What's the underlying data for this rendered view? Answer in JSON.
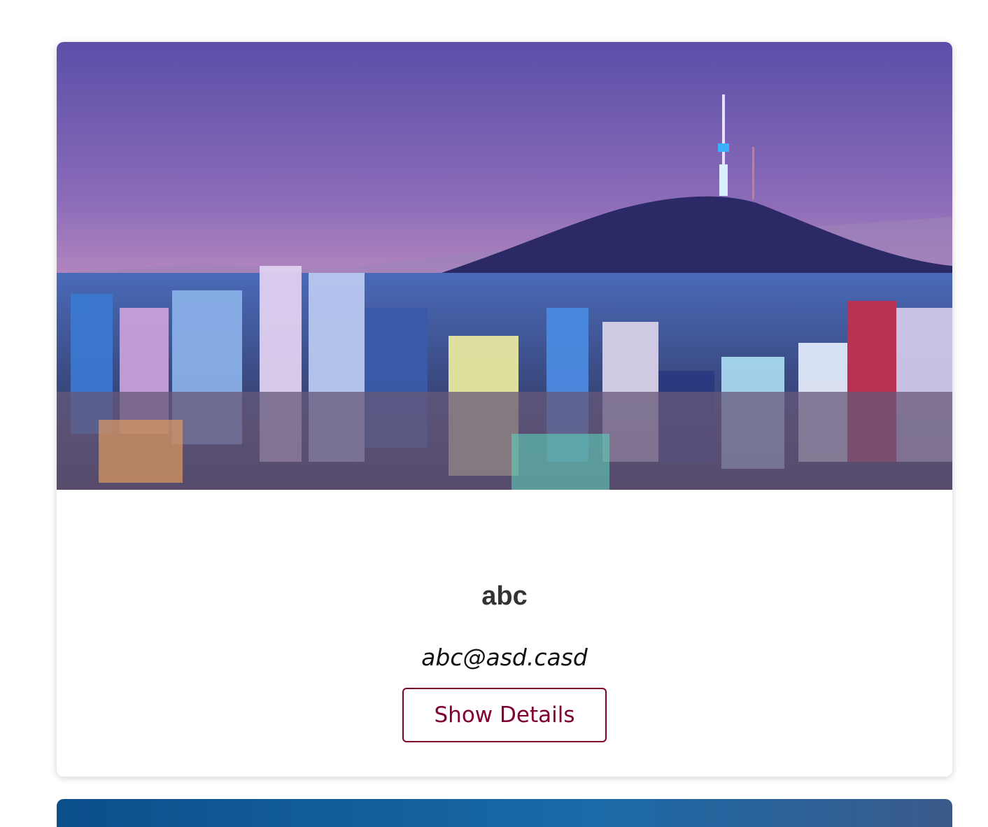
{
  "card": {
    "name": "abc",
    "email": "abc@asd.casd",
    "button_label": "Show Details",
    "image_alt": "Seoul city skyline at night with N Seoul Tower"
  },
  "colors": {
    "accent": "#800033",
    "title": "#333333"
  }
}
